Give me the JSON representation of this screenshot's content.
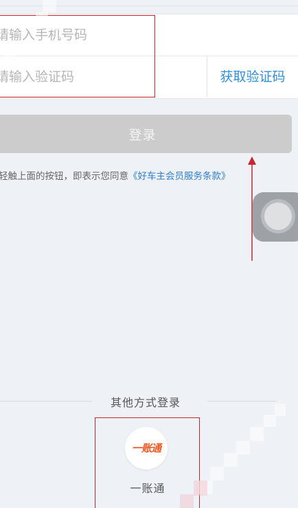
{
  "login_form": {
    "phone_placeholder": "请输入手机号码",
    "code_placeholder": "请输入验证码",
    "get_code_label": "获取验证码"
  },
  "login_button_label": "登录",
  "agreement": {
    "prefix": "轻触上面的按钮，即表示您同意",
    "terms_link": "《好车主会员服务条款》"
  },
  "other_login": {
    "title": "其他方式登录",
    "options": [
      {
        "logo_text": "一账通",
        "label": "一账通"
      }
    ]
  },
  "colors": {
    "accent": "#2f8fd8",
    "annotation_red": "#c8262c",
    "login_button_disabled": "#cccccc",
    "logo_orange": "#f15a24",
    "background": "#eef1f6"
  },
  "icons": {
    "assistive_touch": "assistive-touch-icon",
    "annotation_arrow": "red-arrow-up-icon",
    "yizhangtong_logo": "yizhangtong-logo-icon"
  }
}
